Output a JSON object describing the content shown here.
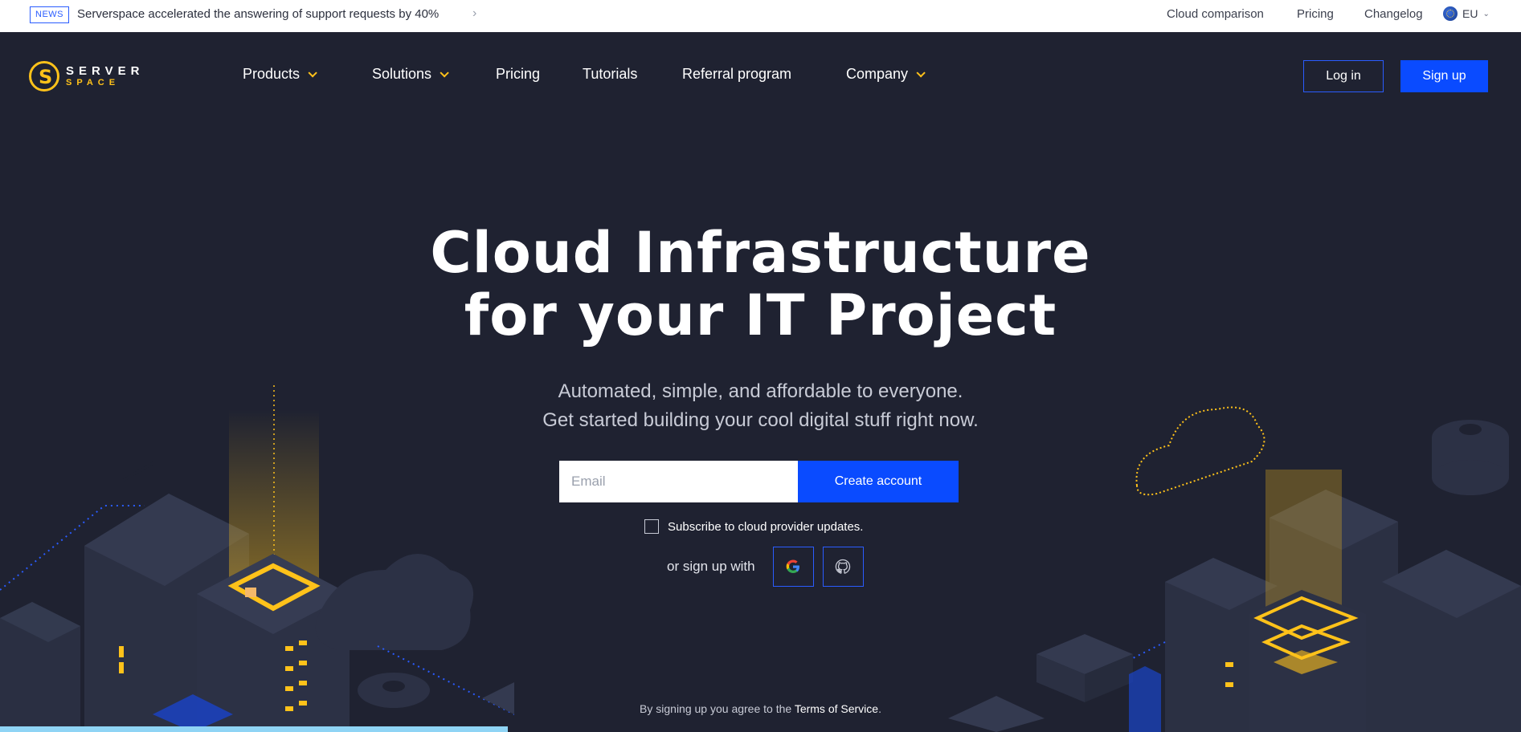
{
  "newsbar": {
    "badge": "NEWS",
    "text": "Serverspace accelerated the answering of support requests by 40%",
    "chevron": "›",
    "links": [
      "Cloud comparison",
      "Pricing",
      "Changelog"
    ],
    "region": "EU"
  },
  "header": {
    "logo_top": "SERVER",
    "logo_bottom": "SPACE",
    "nav": [
      "Products",
      "Solutions",
      "Pricing",
      "Tutorials",
      "Referral program",
      "Company"
    ],
    "login_label": "Log in",
    "signup_label": "Sign up"
  },
  "hero": {
    "title_line1": "Cloud Infrastructure",
    "title_line2": "for your IT Project",
    "sub_line1": "Automated, simple, and affordable to everyone.",
    "sub_line2": "Get started building your cool digital stuff right now.",
    "email_placeholder": "Email",
    "create_label": "Create account",
    "subscribe_label": "Subscribe to cloud provider updates.",
    "social_label": "or sign up with",
    "terms_prefix": "By signing up you agree to the ",
    "terms_link": "Terms of Service",
    "terms_suffix": "."
  },
  "colors": {
    "background": "#1f2231",
    "accent_blue": "#0a4bff",
    "accent_yellow": "#ffc21a"
  }
}
